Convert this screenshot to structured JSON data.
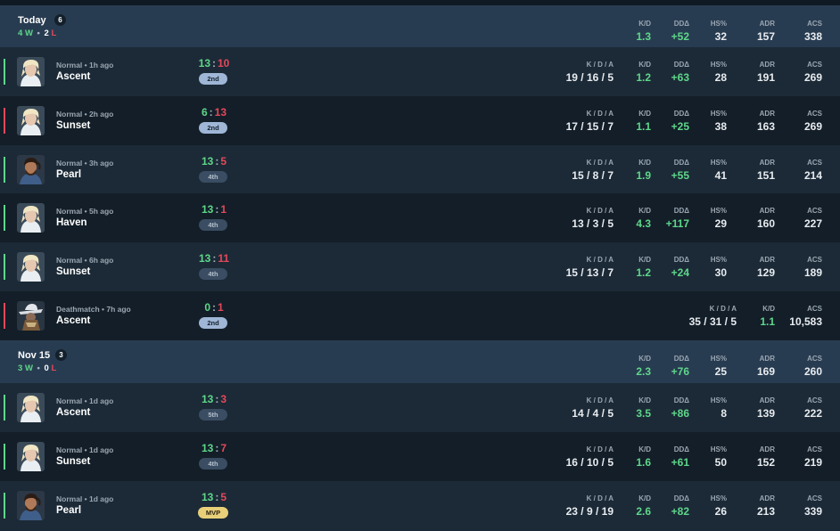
{
  "days": [
    {
      "title": "Today",
      "count": "6",
      "wins": "4",
      "w": "W",
      "losses": "2",
      "l": "L",
      "stats": {
        "kd_label": "K/D",
        "kd": "1.3",
        "dd_label": "DDΔ",
        "dd": "+52",
        "hs_label": "HS%",
        "hs": "32",
        "adr_label": "ADR",
        "adr": "157",
        "acs_label": "ACS",
        "acs": "338"
      }
    },
    {
      "title": "Nov 15",
      "count": "3",
      "wins": "3",
      "w": "W",
      "losses": "0",
      "l": "L",
      "stats": {
        "kd_label": "K/D",
        "kd": "2.3",
        "dd_label": "DDΔ",
        "dd": "+76",
        "hs_label": "HS%",
        "hs": "25",
        "adr_label": "ADR",
        "adr": "169",
        "acs_label": "ACS",
        "acs": "260"
      }
    }
  ],
  "labels": {
    "kda": "K / D / A",
    "kd": "K/D",
    "dd": "DDΔ",
    "hs": "HS%",
    "adr": "ADR",
    "acs": "ACS",
    "colon": ":"
  },
  "matches": [
    {
      "mode": "Normal • 1h ago",
      "map": "Ascent",
      "result": "win",
      "agent": "blonde-agent-icon",
      "score_a": "13",
      "score_b": "10",
      "placement": "2nd",
      "kda": "19 / 16 / 5",
      "kd": "1.2",
      "dd": "+63",
      "hs": "28",
      "adr": "191",
      "acs": "269"
    },
    {
      "mode": "Normal • 2h ago",
      "map": "Sunset",
      "result": "loss",
      "agent": "blonde-agent-icon",
      "score_a": "6",
      "score_b": "13",
      "placement": "2nd",
      "kda": "17 / 15 / 7",
      "kd": "1.1",
      "dd": "+25",
      "hs": "38",
      "adr": "163",
      "acs": "269"
    },
    {
      "mode": "Normal • 3h ago",
      "map": "Pearl",
      "result": "win",
      "agent": "bearded-agent-icon",
      "score_a": "13",
      "score_b": "5",
      "placement": "4th",
      "kda": "15 / 8 / 7",
      "kd": "1.9",
      "dd": "+55",
      "hs": "41",
      "adr": "151",
      "acs": "214"
    },
    {
      "mode": "Normal • 5h ago",
      "map": "Haven",
      "result": "win",
      "agent": "blonde-agent-icon",
      "score_a": "13",
      "score_b": "1",
      "placement": "4th",
      "kda": "13 / 3 / 5",
      "kd": "4.3",
      "dd": "+117",
      "hs": "29",
      "adr": "160",
      "acs": "227"
    },
    {
      "mode": "Normal • 6h ago",
      "map": "Sunset",
      "result": "win",
      "agent": "blonde-agent-icon",
      "score_a": "13",
      "score_b": "11",
      "placement": "4th",
      "kda": "15 / 13 / 7",
      "kd": "1.2",
      "dd": "+24",
      "hs": "30",
      "adr": "129",
      "acs": "189"
    },
    {
      "mode": "Deathmatch • 7h ago",
      "map": "Ascent",
      "result": "loss",
      "agent": "hat-agent-icon",
      "score_a": "0",
      "score_b": "1",
      "placement": "2nd",
      "kda": "35 / 31 / 5",
      "kd": "1.1",
      "acs": "10,583"
    },
    {
      "mode": "Normal • 1d ago",
      "map": "Ascent",
      "result": "win",
      "agent": "blonde-agent-icon",
      "score_a": "13",
      "score_b": "3",
      "placement": "5th",
      "kda": "14 / 4 / 5",
      "kd": "3.5",
      "dd": "+86",
      "hs": "8",
      "adr": "139",
      "acs": "222"
    },
    {
      "mode": "Normal • 1d ago",
      "map": "Sunset",
      "result": "win",
      "agent": "blonde-agent-icon",
      "score_a": "13",
      "score_b": "7",
      "placement": "4th",
      "kda": "16 / 10 / 5",
      "kd": "1.6",
      "dd": "+61",
      "hs": "50",
      "adr": "152",
      "acs": "219"
    },
    {
      "mode": "Normal • 1d ago",
      "map": "Pearl",
      "result": "win",
      "agent": "bearded-agent-icon",
      "score_a": "13",
      "score_b": "5",
      "placement": "MVP",
      "kda": "23 / 9 / 19",
      "kd": "2.6",
      "dd": "+82",
      "hs": "26",
      "adr": "213",
      "acs": "339"
    }
  ]
}
